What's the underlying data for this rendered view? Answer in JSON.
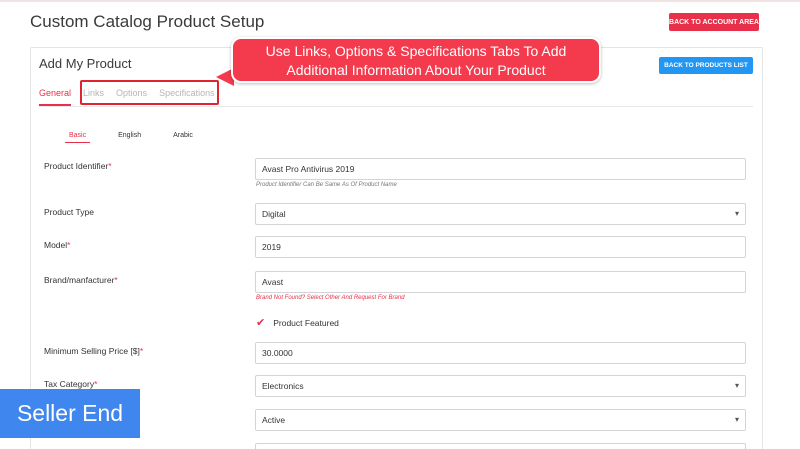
{
  "page": {
    "title": "Custom Catalog Product Setup",
    "back_to_account_label": "BACK TO ACCOUNT AREA"
  },
  "panel": {
    "title": "Add My Product",
    "back_to_products_label": "BACK TO PRODUCTS LIST"
  },
  "tabs": [
    {
      "label": "General",
      "active": true
    },
    {
      "label": "Links",
      "active": false
    },
    {
      "label": "Options",
      "active": false
    },
    {
      "label": "Specifications",
      "active": false
    }
  ],
  "callout": {
    "line1": "Use Links, Options & Specifications Tabs To Add",
    "line2": "Additional Information About Your Product"
  },
  "lang_tabs": [
    {
      "label": "Basic",
      "active": true
    },
    {
      "label": "English",
      "active": false
    },
    {
      "label": "Arabic",
      "active": false
    }
  ],
  "fields": {
    "product_identifier": {
      "label": "Product Identifier",
      "value": "Avast Pro Antivirus 2019",
      "hint": "Product Identifier Can Be Same As Of Product Name"
    },
    "product_type": {
      "label": "Product Type",
      "value": "Digital"
    },
    "model": {
      "label": "Model",
      "value": "2019"
    },
    "brand": {
      "label": "Brand/manfacturer",
      "value": "Avast",
      "hint": "Brand Not Found? Select Other And Request For Brand"
    },
    "product_featured": {
      "label": "Product Featured",
      "checked": true
    },
    "min_selling_price": {
      "label": "Minimum Selling Price [$]",
      "value": "30.0000"
    },
    "tax_category": {
      "label": "Tax Category",
      "value": "Electronics"
    },
    "status": {
      "value": "Active"
    }
  },
  "required_marker": "*",
  "badge": {
    "label": "Seller End"
  },
  "colors": {
    "accent_red": "#e8304a",
    "button_blue": "#2196f3",
    "badge_blue": "#3f86ee",
    "callout_red": "#f43a4d"
  }
}
